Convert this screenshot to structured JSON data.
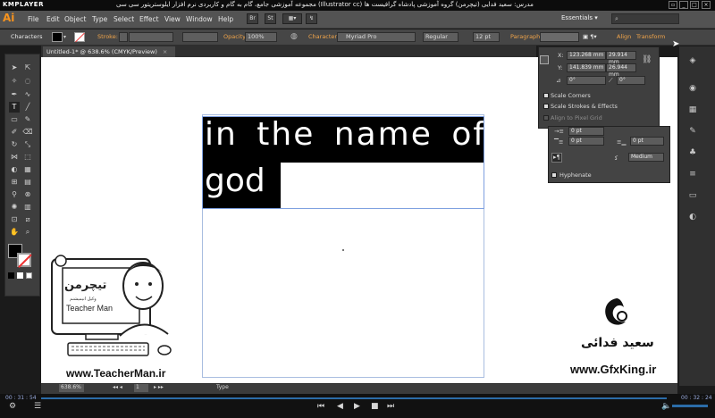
{
  "player": {
    "name": "KMPLAYER",
    "title": "مجموعه آموزشی جامع، گام به گام و کاربردی نرم افزار ایلوستریتور سی سی (Illustrator cc)   مدرس: سعید فدایی (تیچرمن) گروه آموزشی پادشاه گرافیست ها",
    "time_elapsed": "00 : 31 : 54",
    "time_total": "00 : 32 : 24"
  },
  "app": {
    "logo": "Ai",
    "menus": [
      "File",
      "Edit",
      "Object",
      "Type",
      "Select",
      "Effect",
      "View",
      "Window",
      "Help"
    ],
    "workspace": "Essentials",
    "bridge_btn": "Br",
    "stock_btn": "St"
  },
  "control_bar": {
    "panel_name": "Characters",
    "stroke_label": "Stroke:",
    "opacity_label": "Opacity:",
    "opacity_value": "100%",
    "character_label": "Character:",
    "font_value": "Myriad Pro",
    "style_value": "Regular",
    "size_value": "12 pt",
    "paragraph_label": "Paragraph:",
    "align_label": "Align",
    "transform_label": "Transform"
  },
  "document": {
    "tab_title": "Untitled-1* @ 638.6% (CMYK/Preview)",
    "line1": "in the name of",
    "line2": "god",
    "zoom": "638.6%",
    "page_num": "1",
    "status_tool": "Type"
  },
  "transform_panel": {
    "x_label": "X:",
    "x_value": "123.268 mm",
    "y_label": "Y:",
    "y_value": "141.839 mm",
    "w_label": "W:",
    "w_value": "29.914 mm",
    "h_label": "H:",
    "h_value": "26.944 mm",
    "rot_value": "0°",
    "shear_value": "0°",
    "scale_corners": "Scale Corners",
    "scale_strokes": "Scale Strokes & Effects",
    "align_pixel": "Align to Pixel Grid"
  },
  "paragraph_panel": {
    "indent_left": "0 pt",
    "indent_right": "0 pt",
    "space_before": "0 pt",
    "space_after": "0 pt",
    "mode_value": "Medium",
    "hyphenate": "Hyphenate"
  },
  "overlays": {
    "teacherman_logo": "تیچرمن",
    "teacherman_sub": "وکیل انیمیشنم",
    "teacherman_name": "Teacher Man",
    "teacherman_url": "www.TeacherMan.ir",
    "gfx_name": "سعید فدائی",
    "gfx_url": "www.GfxKing.ir"
  }
}
